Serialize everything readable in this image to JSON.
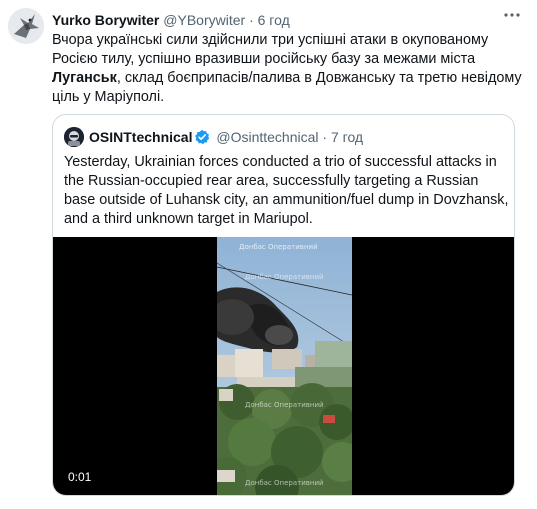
{
  "tweet": {
    "author_name": "Yurko Borywiter",
    "handle": "@YBorywiter",
    "separator": "·",
    "time": "6 год",
    "text_before": "Вчора українські сили здійснили три успішні атаки в окупованому Росією тилу, успішно вразивши російську базу за межами міста ",
    "text_bold": "Луганськ",
    "text_after": ", склад боєприпасів/палива в Довжанську та третю невідому ціль у Маріуполі.",
    "more_icon": "more-horizontal-icon"
  },
  "quote": {
    "author_name": "OSINTtechnical",
    "verified_icon": "verified-badge-icon",
    "handle": "@Osinttechnical",
    "separator": "·",
    "time": "7 год",
    "text": "Yesterday, Ukrainian forces conducted a trio of successful attacks in the Russian-occupied rear area, successfully targeting a Russian base outside of Luhansk city, an ammunition/fuel dump in Dovzhansk, and a third unknown target in Mariupol.",
    "video": {
      "watermark_top": "Донбас Оперативний",
      "watermark_mid": "Донбас Оперативний",
      "watermark_low": "Донбас Оперативний",
      "watermark_bottom": "Донбас Оперативний",
      "timestamp": "0:01"
    }
  },
  "colors": {
    "text_primary": "#0f1419",
    "text_secondary": "#536471",
    "border": "#cfd9de",
    "verified": "#1d9bf0",
    "smoke": "#2b2b2b"
  }
}
